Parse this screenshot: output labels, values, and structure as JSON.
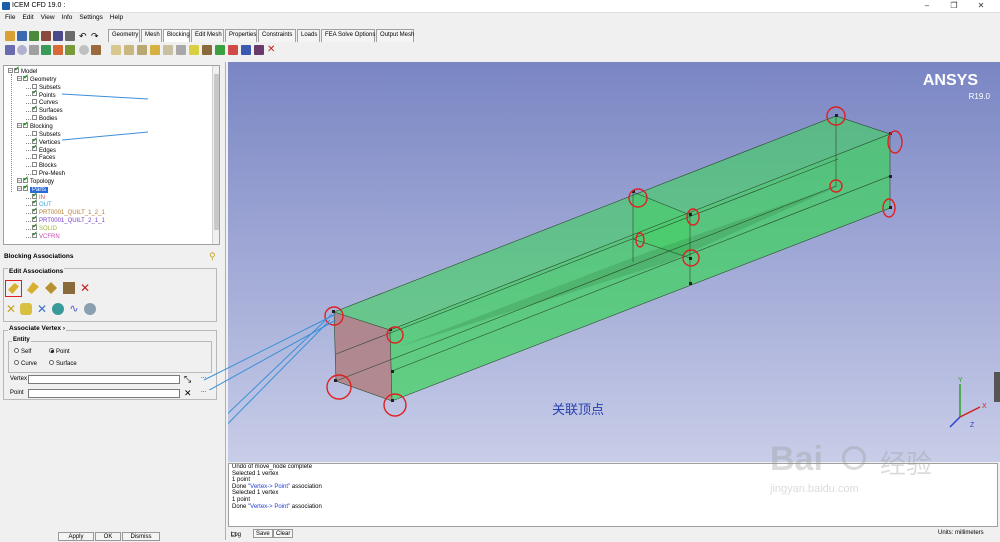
{
  "window": {
    "title": "ICEM CFD 19.0 :",
    "controls": [
      "–",
      "❐",
      "✕"
    ]
  },
  "menu": [
    "File",
    "Edit",
    "View",
    "Info",
    "Settings",
    "Help"
  ],
  "tabs": [
    "Geometry",
    "Mesh",
    "Blocking",
    "Edit Mesh",
    "Properties",
    "Constraints",
    "Loads",
    "FEA Solve Options",
    "Output Mesh"
  ],
  "active_tab": "Blocking",
  "tree": [
    {
      "label": "Model",
      "level": 0,
      "checked": true,
      "color": "#000000"
    },
    {
      "label": "Geometry",
      "level": 1,
      "checked": true,
      "color": "#000000"
    },
    {
      "label": "Subsets",
      "level": 2,
      "checked": false,
      "color": "#000000"
    },
    {
      "label": "Points",
      "level": 2,
      "checked": true,
      "color": "#000000"
    },
    {
      "label": "Curves",
      "level": 2,
      "checked": false,
      "color": "#000000"
    },
    {
      "label": "Surfaces",
      "level": 2,
      "checked": true,
      "color": "#000000"
    },
    {
      "label": "Bodies",
      "level": 2,
      "checked": false,
      "color": "#000000"
    },
    {
      "label": "Blocking",
      "level": 1,
      "checked": true,
      "color": "#000000"
    },
    {
      "label": "Subsets",
      "level": 2,
      "checked": false,
      "color": "#000000"
    },
    {
      "label": "Vertices",
      "level": 2,
      "checked": true,
      "color": "#000000"
    },
    {
      "label": "Edges",
      "level": 2,
      "checked": true,
      "color": "#000000"
    },
    {
      "label": "Faces",
      "level": 2,
      "checked": false,
      "color": "#000000"
    },
    {
      "label": "Blocks",
      "level": 2,
      "checked": false,
      "color": "#000000"
    },
    {
      "label": "Pre-Mesh",
      "level": 2,
      "checked": false,
      "color": "#000000"
    },
    {
      "label": "Topology",
      "level": 1,
      "checked": true,
      "color": "#000000"
    },
    {
      "label": "Parts",
      "level": 1,
      "checked": true,
      "color": "#ffffff",
      "selected": true
    },
    {
      "label": "IN",
      "level": 2,
      "checked": true,
      "color": "#d44a4a"
    },
    {
      "label": "OUT",
      "level": 2,
      "checked": true,
      "color": "#3aa0d8"
    },
    {
      "label": "PRT0001_QUILT_1_2_1",
      "level": 2,
      "checked": true,
      "color": "#b07a2a"
    },
    {
      "label": "PRT0001_QUILT_2_1_1",
      "level": 2,
      "checked": true,
      "color": "#7a3ad0"
    },
    {
      "label": "SOLID",
      "level": 2,
      "checked": true,
      "color": "#9ab83a"
    },
    {
      "label": "VCFRN",
      "level": 2,
      "checked": true,
      "color": "#c04ab0"
    }
  ],
  "panel": {
    "title": "Blocking Associations",
    "edit_assoc": "Edit Associations",
    "assoc_vertex": "Associate Vertex",
    "assoc_arrow": "›",
    "entity": "Entity",
    "radios": [
      {
        "label": "Self",
        "on": false
      },
      {
        "label": "Point",
        "on": true
      },
      {
        "label": "Curve",
        "on": false
      },
      {
        "label": "Surface",
        "on": false
      }
    ],
    "vertex_label": "Vertex",
    "vertex_value": "",
    "point_label": "Point",
    "point_value": "",
    "dots": "...",
    "buttons": [
      "Apply",
      "OK",
      "Dismiss"
    ]
  },
  "viewport": {
    "brand": "ANSYS",
    "version": "R19.0",
    "caption": "关联顶点",
    "bg_top": "#7a86c4",
    "bg_bottom": "#c8cde8",
    "box_color": "#3fd25e",
    "end_color": "#b07a7a",
    "circle_color": "#e02020",
    "arrow_color": "#3a8fd8",
    "axes": {
      "x": "X",
      "y": "Y",
      "z": "Z"
    }
  },
  "messages": [
    {
      "text": "Undo of move_node complete"
    },
    {
      "text": "Selected 1 vertex"
    },
    {
      "text": "1 point"
    },
    {
      "pre": "Done ",
      "hl": "\"Vertex-> Point\"",
      "post": " association"
    },
    {
      "text": "Selected 1 vertex"
    },
    {
      "text": "1 point"
    },
    {
      "pre": "Done ",
      "hl": "\"Vertex-> Point\"",
      "post": " association"
    }
  ],
  "msgbar": {
    "log": "Log",
    "save": "Save",
    "clear": "Clear",
    "units": "Units: millimeters"
  },
  "watermark": {
    "brand": "Bai",
    "mid": "经验",
    "url": "jingyan.baidu.com"
  }
}
